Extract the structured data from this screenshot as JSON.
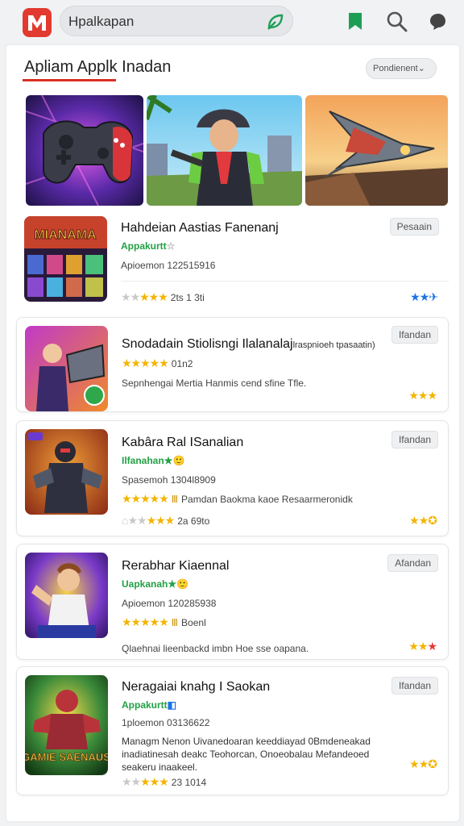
{
  "header": {
    "search_value": " Hpalkapan",
    "icons": [
      "app-logo",
      "leaf-icon",
      "bookmark-icon",
      "search-icon",
      "chat-icon"
    ]
  },
  "section": {
    "title": "Apliam Applk Inadan",
    "sort_label": "Pondienent",
    "sort_chevron": "⌄"
  },
  "apps": [
    {
      "name": "Hahdeian Aastias Fanenanj",
      "dev": "Appakurtt",
      "dev_suffix": "☆",
      "meta": "Apioemon 122515916",
      "tag": "Pesaain",
      "rating_text": "2ts 1 3ti",
      "thumb_label": "MIANAMA"
    },
    {
      "name": "Snodadain Stiolisngi Ilalanalaj",
      "name_small": "lraspnioeh tpasaatin)",
      "rating_text": "01n2",
      "meta": "Sepnhengai Mertia Hanmis cend sfine Tfle.",
      "tag": "Ifandan"
    },
    {
      "name": "Kabâra Ral ISanalian",
      "dev": "Ilfanahan★",
      "dev_suffix": "🙂",
      "meta": "Spasemoh 1304l8909",
      "meta2": "Pamdan Baokma kaoe Resaarmeronidk",
      "tag": "Ifandan",
      "rating_text": "2a 69to"
    },
    {
      "name": "Rerabhar Kiaennal",
      "dev": "Uapkanah★",
      "dev_suffix": "🙂",
      "meta": "Apioemon 120285938",
      "meta2": "Boenl",
      "desc": "Qlaehnai lieenbackd imbn Hoe sse oapana.",
      "tag": "Afandan"
    },
    {
      "name": "Neragaiai knahg I Saokan",
      "dev": "Appakurtt",
      "dev_suffix": "◧",
      "meta": "1ploemon 03136622",
      "desc": "Managm Nenon Uivanedoaran keeddiayad 0Bmdeneakad inadiatinesah deakc Teohorcan, Onoeobalau Mefandeoed seakeru inaakeel.",
      "tag": "Ifandan",
      "rating_text": "23 1014",
      "thumb_label": "GAMIE SAENAUS"
    }
  ],
  "colors": {
    "accent_red": "#d93025",
    "dev_green": "#22a045",
    "star_gold": "#f4b400",
    "star_blue": "#1a73e8"
  }
}
